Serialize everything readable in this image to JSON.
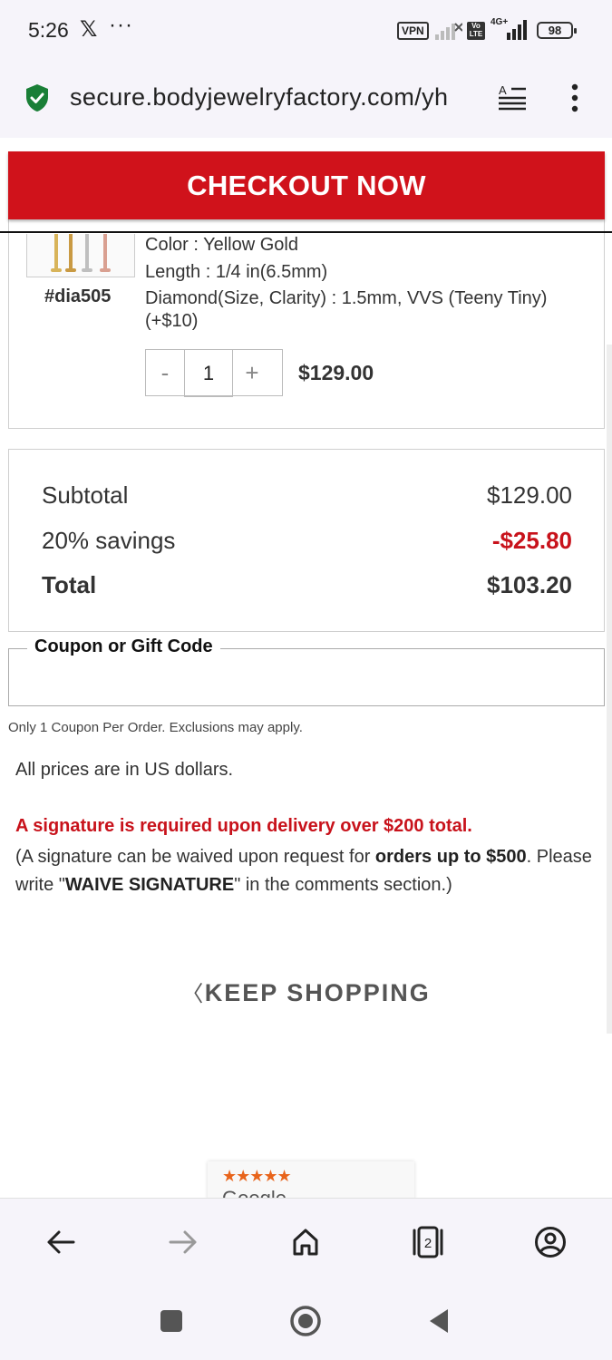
{
  "status_bar": {
    "time": "5:26",
    "x_app": "𝕏",
    "more": "···",
    "vpn": "VPN",
    "volte": "Vo LTE",
    "network": "4G+",
    "battery": "98"
  },
  "browser": {
    "url": "secure.bodyjewelryfactory.com/yh",
    "secure_icon": "shield-check-icon",
    "reader_icon": "reader-mode-icon",
    "menu_icon": "kebab-menu-icon"
  },
  "checkout": {
    "label": "CHECKOUT NOW",
    "color": "#d0121b"
  },
  "item": {
    "sku": "#dia505",
    "color": "Color : Yellow Gold",
    "length": "Length : 1/4 in(6.5mm)",
    "diamond_line1": "Diamond(Size, Clarity) : 1.5mm, VVS (Teeny Tiny)",
    "diamond_line2": "(+$10)",
    "qty_minus": "-",
    "qty_value": "1",
    "qty_plus": "+",
    "price": "$129.00"
  },
  "summary": {
    "subtotal_label": "Subtotal",
    "subtotal_value": "$129.00",
    "savings_label": "20% savings",
    "savings_value": "-$25.80",
    "total_label": "Total",
    "total_value": "$103.20",
    "accent_color": "#c8121b"
  },
  "coupon": {
    "legend": "Coupon or Gift Code",
    "placeholder": "",
    "note": "Only 1 Coupon Per Order. Exclusions may apply."
  },
  "notes": {
    "prices": "All prices are in US dollars.",
    "signature_warning": "A signature is required upon delivery over $200 total.",
    "sig_part1": "(A signature can be waived upon request for ",
    "sig_bold1": "orders up to $500",
    "sig_part2": ". Please write \"",
    "sig_bold2": "WAIVE SIGNATURE",
    "sig_part3": "\" in the comments section.)"
  },
  "keep_shopping": {
    "chevron": "〈",
    "label": "KEEP SHOPPING"
  },
  "review_badge": {
    "stars": "★★★★★",
    "brand": "Google"
  },
  "browser_nav": {
    "back_icon": "arrow-left-icon",
    "forward_icon": "arrow-right-icon",
    "home_icon": "home-icon",
    "tabs_count": "2",
    "account_icon": "account-circle-icon"
  },
  "system_nav": {
    "recents_icon": "square-icon",
    "home_icon": "circle-icon",
    "back_icon": "triangle-back-icon"
  }
}
